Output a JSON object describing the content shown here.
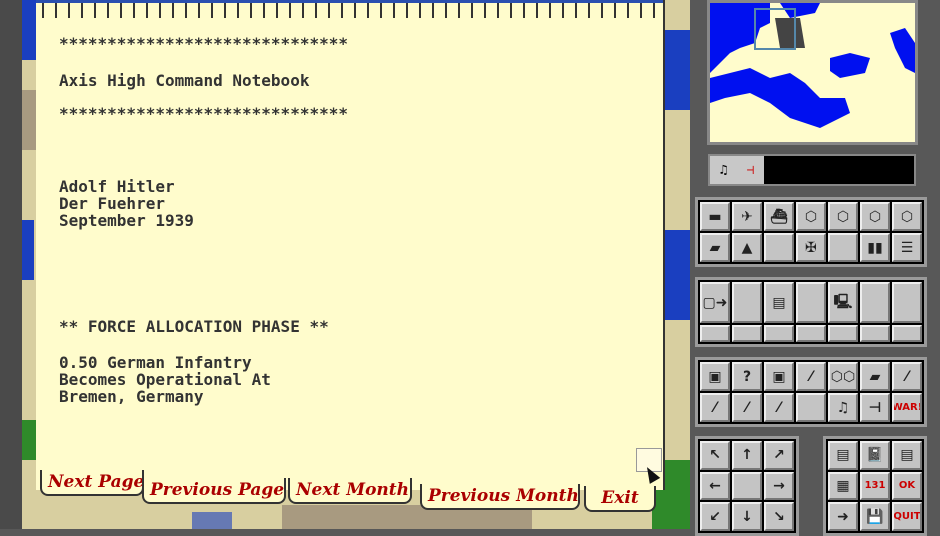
{
  "notebook": {
    "stars_top": "******************************",
    "title": "Axis High Command Notebook",
    "stars_bottom": "******************************",
    "author_name": "Adolf Hitler",
    "author_title": "Der Fuehrer",
    "date": "September 1939",
    "phase": "** FORCE ALLOCATION PHASE **",
    "message_line1": "0.50 German Infantry",
    "message_line2": "Becomes Operational At",
    "message_line3": "Bremen, Germany"
  },
  "tabs": {
    "next_page": "Next Page",
    "previous_page": "Previous Page",
    "next_month": "Next Month",
    "previous_month": "Previous Month",
    "exit": "Exit"
  },
  "status": {
    "music_icon": "♫",
    "sound_icon": "⊣"
  },
  "colors": {
    "paper": "#fffccc",
    "water": "#1a3fc0",
    "tab_text": "#aa0000",
    "panel": "#585858"
  },
  "groups": [
    {
      "name": "unit-type-buttons",
      "cols": 7,
      "buttons": [
        {
          "icon": "tank-icon",
          "glyph": "▬"
        },
        {
          "icon": "aircraft-icon",
          "glyph": "✈"
        },
        {
          "icon": "ship-icon",
          "glyph": "⛴"
        },
        {
          "icon": "armor-hex-icon",
          "glyph": "⬡"
        },
        {
          "icon": "fleet-hex-icon",
          "glyph": "⬡"
        },
        {
          "icon": "rail-hex-icon",
          "glyph": "⬡"
        },
        {
          "icon": "transport-hex-icon",
          "glyph": "⬡"
        },
        {
          "icon": "truck-icon",
          "glyph": "▰"
        },
        {
          "icon": "terrain-icon",
          "glyph": "▲"
        },
        {
          "icon": "empty",
          "glyph": ""
        },
        {
          "icon": "iron-cross-icon",
          "glyph": "✠"
        },
        {
          "icon": "empty",
          "glyph": ""
        },
        {
          "icon": "blue-panels-icon",
          "glyph": "▮▮"
        },
        {
          "icon": "list-icon",
          "glyph": "☰"
        }
      ]
    },
    {
      "name": "report-buttons",
      "cols": 7,
      "buttons": [
        {
          "icon": "move-out-icon",
          "glyph": "▢➜"
        },
        {
          "icon": "empty",
          "glyph": ""
        },
        {
          "icon": "board-icon",
          "glyph": "▤"
        },
        {
          "icon": "empty",
          "glyph": ""
        },
        {
          "icon": "computer-icon",
          "glyph": "🖳"
        },
        {
          "icon": "empty",
          "glyph": ""
        },
        {
          "icon": "empty",
          "glyph": ""
        },
        {
          "icon": "empty",
          "glyph": ""
        },
        {
          "icon": "empty",
          "glyph": ""
        },
        {
          "icon": "empty",
          "glyph": ""
        },
        {
          "icon": "empty",
          "glyph": ""
        },
        {
          "icon": "empty",
          "glyph": ""
        },
        {
          "icon": "empty",
          "glyph": ""
        },
        {
          "icon": "empty",
          "glyph": ""
        }
      ]
    },
    {
      "name": "option-buttons",
      "cols": 7,
      "buttons": [
        {
          "icon": "disk-icon",
          "glyph": "▣"
        },
        {
          "icon": "question-hex-icon",
          "glyph": "?"
        },
        {
          "icon": "disks-icon",
          "glyph": "▣"
        },
        {
          "icon": "terrain-toggle-icon",
          "glyph": "⁄"
        },
        {
          "icon": "hex-grid-icon",
          "glyph": "⬡⬡"
        },
        {
          "icon": "supply-truck-icon",
          "glyph": "▰"
        },
        {
          "icon": "terrain-box-toggle-icon",
          "glyph": "⁄"
        },
        {
          "icon": "soldier-toggle-icon",
          "glyph": "⁄"
        },
        {
          "icon": "flag-toggle-icon",
          "glyph": "⁄"
        },
        {
          "icon": "flag-toggle-2-icon",
          "glyph": "⁄"
        },
        {
          "icon": "empty",
          "glyph": ""
        },
        {
          "icon": "music-icon",
          "glyph": "♫"
        },
        {
          "icon": "sound-icon",
          "glyph": "⊣"
        },
        {
          "icon": "war-icon",
          "glyph": "WAR!"
        }
      ]
    },
    {
      "name": "scroll-arrows",
      "cols": 3,
      "buttons": [
        {
          "icon": "arrow-up-left-icon",
          "glyph": "↖"
        },
        {
          "icon": "arrow-up-icon",
          "glyph": "↑"
        },
        {
          "icon": "arrow-up-right-icon",
          "glyph": "↗"
        },
        {
          "icon": "arrow-left-icon",
          "glyph": "←"
        },
        {
          "icon": "empty",
          "glyph": ""
        },
        {
          "icon": "arrow-right-icon",
          "glyph": "→"
        },
        {
          "icon": "arrow-down-left-icon",
          "glyph": "↙"
        },
        {
          "icon": "arrow-down-icon",
          "glyph": "↓"
        },
        {
          "icon": "arrow-down-right-icon",
          "glyph": "↘"
        }
      ]
    },
    {
      "name": "command-buttons",
      "cols": 3,
      "buttons": [
        {
          "icon": "brick-board-icon",
          "glyph": "▤"
        },
        {
          "icon": "notebook-icon",
          "glyph": "📓"
        },
        {
          "icon": "note-icon",
          "glyph": "▤"
        },
        {
          "icon": "monitor-icon",
          "glyph": "▦"
        },
        {
          "icon": "counter-131-icon",
          "glyph": "131"
        },
        {
          "icon": "ok-icon",
          "glyph": "OK"
        },
        {
          "icon": "end-turn-arrow-icon",
          "glyph": "➜"
        },
        {
          "icon": "save-disk-icon",
          "glyph": "💾"
        },
        {
          "icon": "quit-icon",
          "glyph": "QUIT"
        }
      ]
    }
  ]
}
